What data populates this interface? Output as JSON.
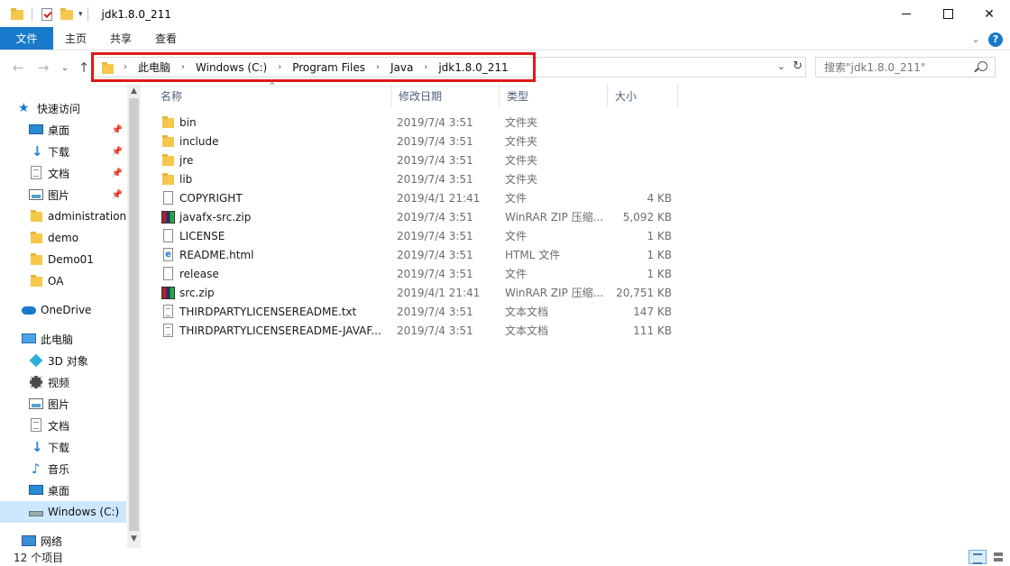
{
  "window": {
    "title": "jdk1.8.0_211",
    "minimize": "",
    "maximize": "",
    "close": "✕"
  },
  "ribbon": {
    "tabs": [
      "文件",
      "主页",
      "共享",
      "查看"
    ],
    "help": "?"
  },
  "address": {
    "crumbs": [
      "此电脑",
      "Windows (C:)",
      "Program Files",
      "Java",
      "jdk1.8.0_211"
    ],
    "separator": "›",
    "highlight_color": "#e01919"
  },
  "search": {
    "placeholder": "搜索\"jdk1.8.0_211\""
  },
  "nav": {
    "quick_access": "快速访问",
    "items": [
      {
        "label": "快速访问",
        "icon": "star-icon"
      },
      {
        "label": "桌面",
        "icon": "desktop-icon",
        "pinned": true
      },
      {
        "label": "下载",
        "icon": "download-icon",
        "pinned": true
      },
      {
        "label": "文档",
        "icon": "document-icon",
        "pinned": true
      },
      {
        "label": "图片",
        "icon": "pictures-icon",
        "pinned": true
      },
      {
        "label": "administration",
        "icon": "folder-icon"
      },
      {
        "label": "demo",
        "icon": "folder-icon"
      },
      {
        "label": "Demo01",
        "icon": "folder-icon"
      },
      {
        "label": "OA",
        "icon": "folder-icon"
      },
      {
        "label": "OneDrive",
        "icon": "onedrive-icon"
      },
      {
        "label": "此电脑",
        "icon": "this-pc-icon"
      },
      {
        "label": "3D 对象",
        "icon": "3d-objects-icon"
      },
      {
        "label": "视频",
        "icon": "videos-icon"
      },
      {
        "label": "图片",
        "icon": "pictures-icon"
      },
      {
        "label": "文档",
        "icon": "document-icon"
      },
      {
        "label": "下载",
        "icon": "download-icon"
      },
      {
        "label": "音乐",
        "icon": "music-icon"
      },
      {
        "label": "桌面",
        "icon": "desktop-icon"
      },
      {
        "label": "Windows (C:)",
        "icon": "drive-icon",
        "selected": true
      },
      {
        "label": "网络",
        "icon": "network-icon"
      }
    ]
  },
  "columns": {
    "name": "名称",
    "date": "修改日期",
    "type": "类型",
    "size": "大小"
  },
  "files": [
    {
      "name": "bin",
      "date": "2019/7/4 3:51",
      "type": "文件夹",
      "size": "",
      "icon": "folder"
    },
    {
      "name": "include",
      "date": "2019/7/4 3:51",
      "type": "文件夹",
      "size": "",
      "icon": "folder"
    },
    {
      "name": "jre",
      "date": "2019/7/4 3:51",
      "type": "文件夹",
      "size": "",
      "icon": "folder"
    },
    {
      "name": "lib",
      "date": "2019/7/4 3:51",
      "type": "文件夹",
      "size": "",
      "icon": "folder"
    },
    {
      "name": "COPYRIGHT",
      "date": "2019/4/1 21:41",
      "type": "文件",
      "size": "4 KB",
      "icon": "file"
    },
    {
      "name": "javafx-src.zip",
      "date": "2019/7/4 3:51",
      "type": "WinRAR ZIP 压缩...",
      "size": "5,092 KB",
      "icon": "zip"
    },
    {
      "name": "LICENSE",
      "date": "2019/7/4 3:51",
      "type": "文件",
      "size": "1 KB",
      "icon": "file"
    },
    {
      "name": "README.html",
      "date": "2019/7/4 3:51",
      "type": "HTML 文件",
      "size": "1 KB",
      "icon": "html"
    },
    {
      "name": "release",
      "date": "2019/7/4 3:51",
      "type": "文件",
      "size": "1 KB",
      "icon": "file"
    },
    {
      "name": "src.zip",
      "date": "2019/4/1 21:41",
      "type": "WinRAR ZIP 压缩...",
      "size": "20,751 KB",
      "icon": "zip"
    },
    {
      "name": "THIRDPARTYLICENSEREADME.txt",
      "date": "2019/7/4 3:51",
      "type": "文本文档",
      "size": "147 KB",
      "icon": "txt"
    },
    {
      "name": "THIRDPARTYLICENSEREADME-JAVAF...",
      "date": "2019/7/4 3:51",
      "type": "文本文档",
      "size": "111 KB",
      "icon": "txt"
    }
  ],
  "status": {
    "count": "12 个项目"
  },
  "colors": {
    "accent": "#1979ca",
    "selected": "#cce8ff"
  }
}
